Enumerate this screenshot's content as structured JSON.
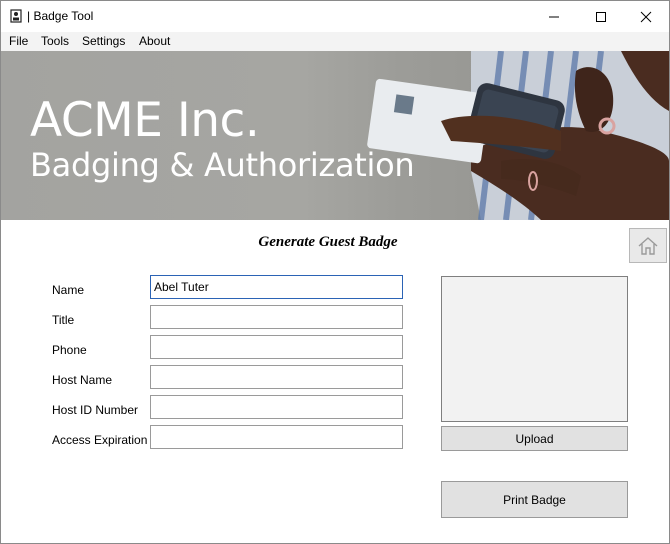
{
  "window": {
    "title": "Badge Tool",
    "controls": [
      "minimize-icon",
      "maximize-icon",
      "close-icon"
    ]
  },
  "menu": {
    "items": [
      "File",
      "Tools",
      "Settings",
      "About"
    ]
  },
  "banner": {
    "title": "ACME Inc.",
    "subtitle": "Badging & Authorization"
  },
  "form": {
    "heading": "Generate Guest Badge",
    "home_icon": "home-icon",
    "fields": [
      {
        "label": "Name",
        "value": "Abel Tuter"
      },
      {
        "label": "Title",
        "value": ""
      },
      {
        "label": "Phone",
        "value": ""
      },
      {
        "label": "Host Name",
        "value": ""
      },
      {
        "label": "Host ID Number",
        "value": ""
      },
      {
        "label": "Access Expiration",
        "value": ""
      }
    ],
    "upload_label": "Upload",
    "print_label": "Print Badge"
  },
  "colors": {
    "banner_bg": "#a3a3a0",
    "button_bg": "#e1e1e1",
    "active_border": "#2b63b5"
  }
}
